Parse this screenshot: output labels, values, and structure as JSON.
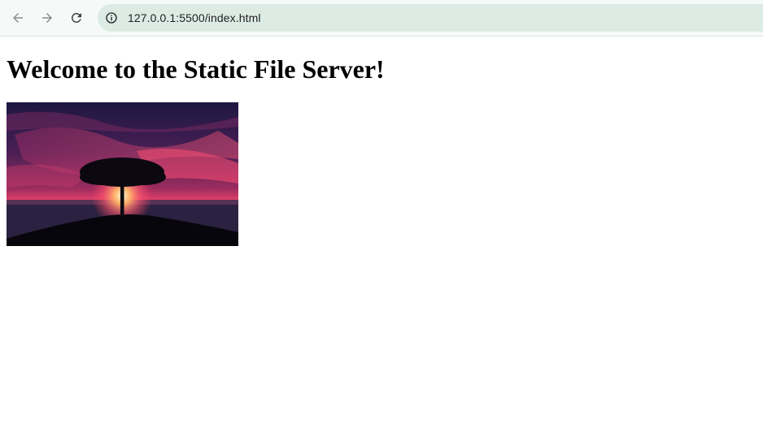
{
  "browser": {
    "url": "127.0.0.1:5500/index.html",
    "icons": {
      "back": "arrow-left-icon",
      "forward": "arrow-right-icon",
      "reload": "reload-icon",
      "site_info": "info-icon"
    }
  },
  "page": {
    "heading": "Welcome to the Static File Server!",
    "image": {
      "subject": "tree-silhouette-sunset-photo"
    }
  },
  "colors": {
    "toolbar_bg": "#f5f9f7",
    "address_bg": "#dcece5",
    "sky_top": "#1c1740",
    "sky_glow": "#e0406a",
    "ground": "#07060c"
  }
}
